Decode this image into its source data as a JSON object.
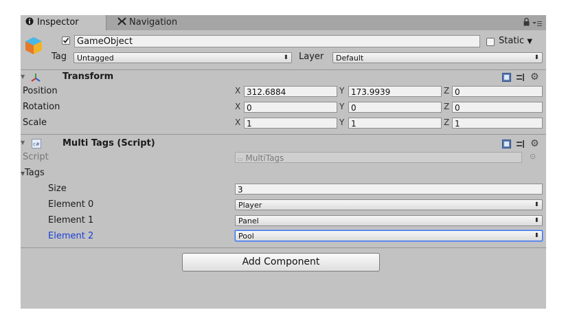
{
  "tabs": {
    "inspector": "Inspector",
    "navigation": "Navigation"
  },
  "object": {
    "active": true,
    "name": "GameObject",
    "static_label": "Static",
    "tag_label": "Tag",
    "tag_value": "Untagged",
    "layer_label": "Layer",
    "layer_value": "Default"
  },
  "transform": {
    "title": "Transform",
    "rows": [
      {
        "label": "Position",
        "x": "312.6884",
        "y": "173.9939",
        "z": "0"
      },
      {
        "label": "Rotation",
        "x": "0",
        "y": "0",
        "z": "0"
      },
      {
        "label": "Scale",
        "x": "1",
        "y": "1",
        "z": "1"
      }
    ],
    "axes": {
      "x": "X",
      "y": "Y",
      "z": "Z"
    }
  },
  "script": {
    "title": "Multi Tags (Script)",
    "script_label": "Script",
    "script_value": "MultiTags",
    "tags_label": "Tags",
    "size_label": "Size",
    "size_value": "3",
    "elements": [
      {
        "label": "Element 0",
        "value": "Player"
      },
      {
        "label": "Element 1",
        "value": "Panel"
      },
      {
        "label": "Element 2",
        "value": "Pool"
      }
    ]
  },
  "add_component": "Add Component",
  "icons": {
    "info": "info-icon",
    "navigation": "navigation-icon",
    "lock": "lock-icon",
    "menu": "menu-icon",
    "gameobject": "cube-icon",
    "transform": "transform-axes-icon",
    "script": "csharp-script-icon",
    "help": "help-book-icon",
    "settings": "gear-icon"
  },
  "colors": {
    "panel": "#c2c2c2",
    "tabbar": "#a5a5a5",
    "selected_label": "#1a3fd6",
    "focus_border": "#3a6ee8"
  }
}
